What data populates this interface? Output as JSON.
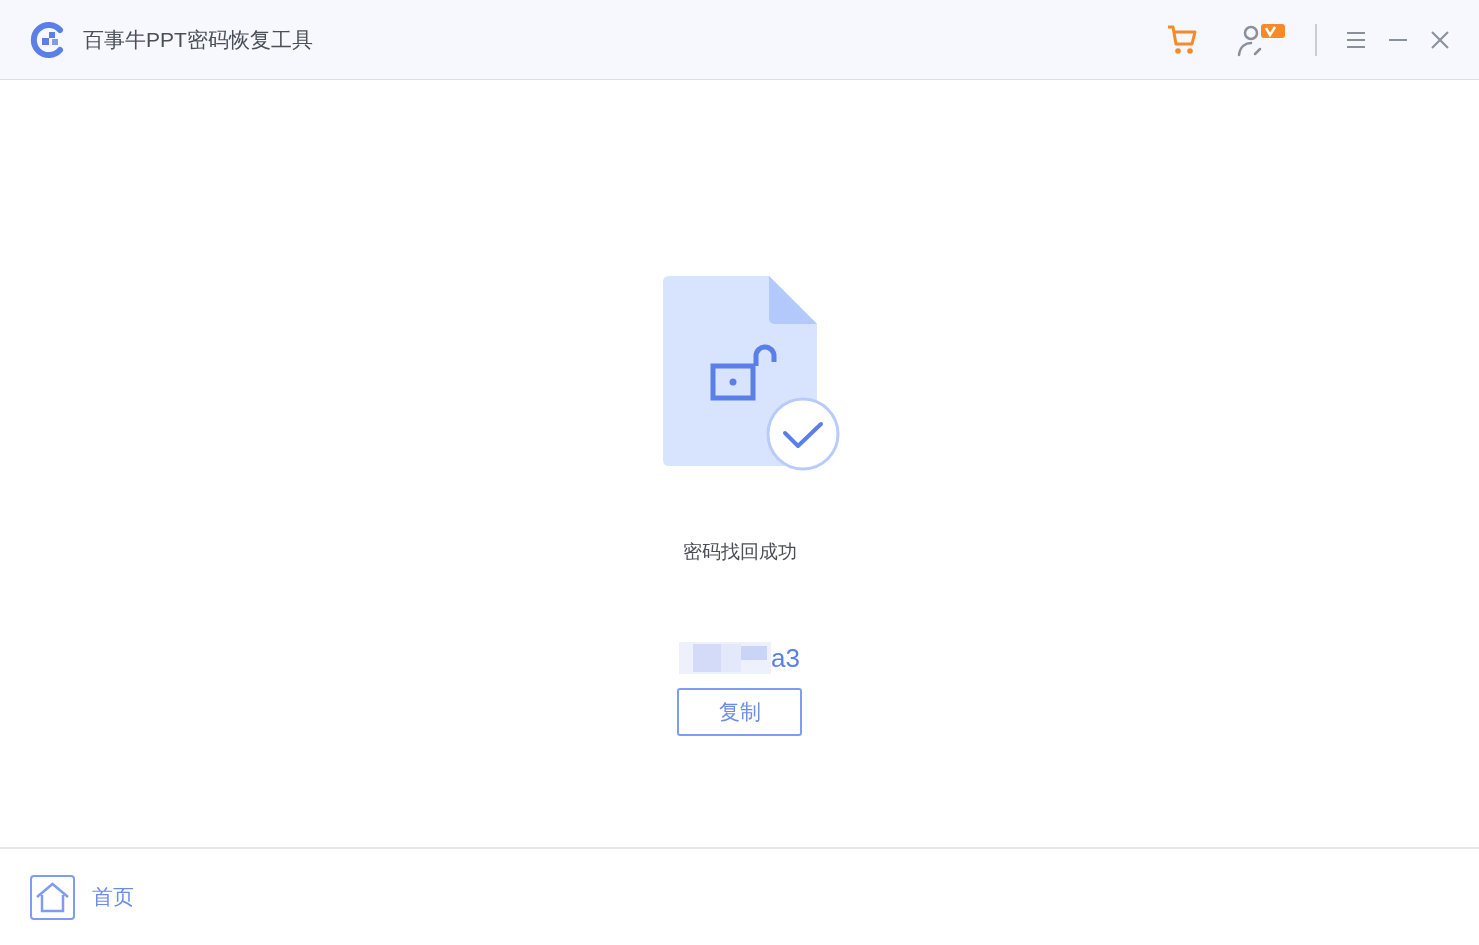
{
  "window": {
    "title": "百事牛PPT密码恢复工具"
  },
  "result": {
    "message": "密码找回成功",
    "password_tail": "a3",
    "copy_button": "复制"
  },
  "footer": {
    "home_link": "首页"
  }
}
